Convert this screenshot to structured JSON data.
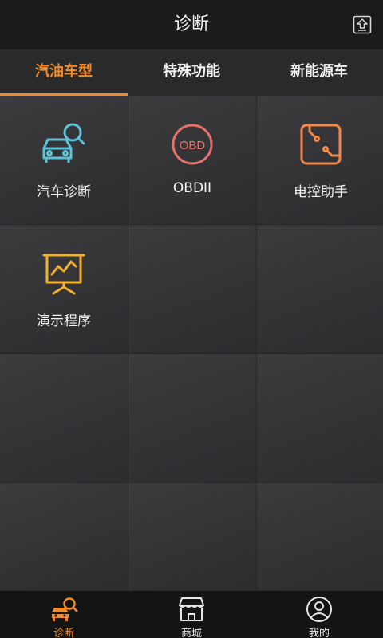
{
  "header": {
    "title": "诊断",
    "upload_icon": "upload-icon"
  },
  "tabs": [
    {
      "label": "汽油车型",
      "active": true
    },
    {
      "label": "特殊功能",
      "active": false
    },
    {
      "label": "新能源车",
      "active": false
    }
  ],
  "grid": {
    "items": [
      {
        "label": "汽车诊断",
        "icon": "car-search-icon",
        "color": "#5ec3d6"
      },
      {
        "label": "OBDII",
        "icon": "obd-icon",
        "icon_text": "OBD",
        "color": "#e8706a"
      },
      {
        "label": "电控助手",
        "icon": "ecu-assistant-icon",
        "color": "#ef8a4a"
      },
      {
        "label": "演示程序",
        "icon": "presentation-icon",
        "color": "#f2b12e"
      }
    ]
  },
  "bottom_nav": [
    {
      "label": "诊断",
      "icon": "car-diagnose-icon",
      "active": true
    },
    {
      "label": "商城",
      "icon": "store-icon",
      "active": false
    },
    {
      "label": "我的",
      "icon": "user-icon",
      "active": false
    }
  ],
  "colors": {
    "accent": "#f08a2a",
    "background": "#333336",
    "bar": "#1b1b1b"
  }
}
